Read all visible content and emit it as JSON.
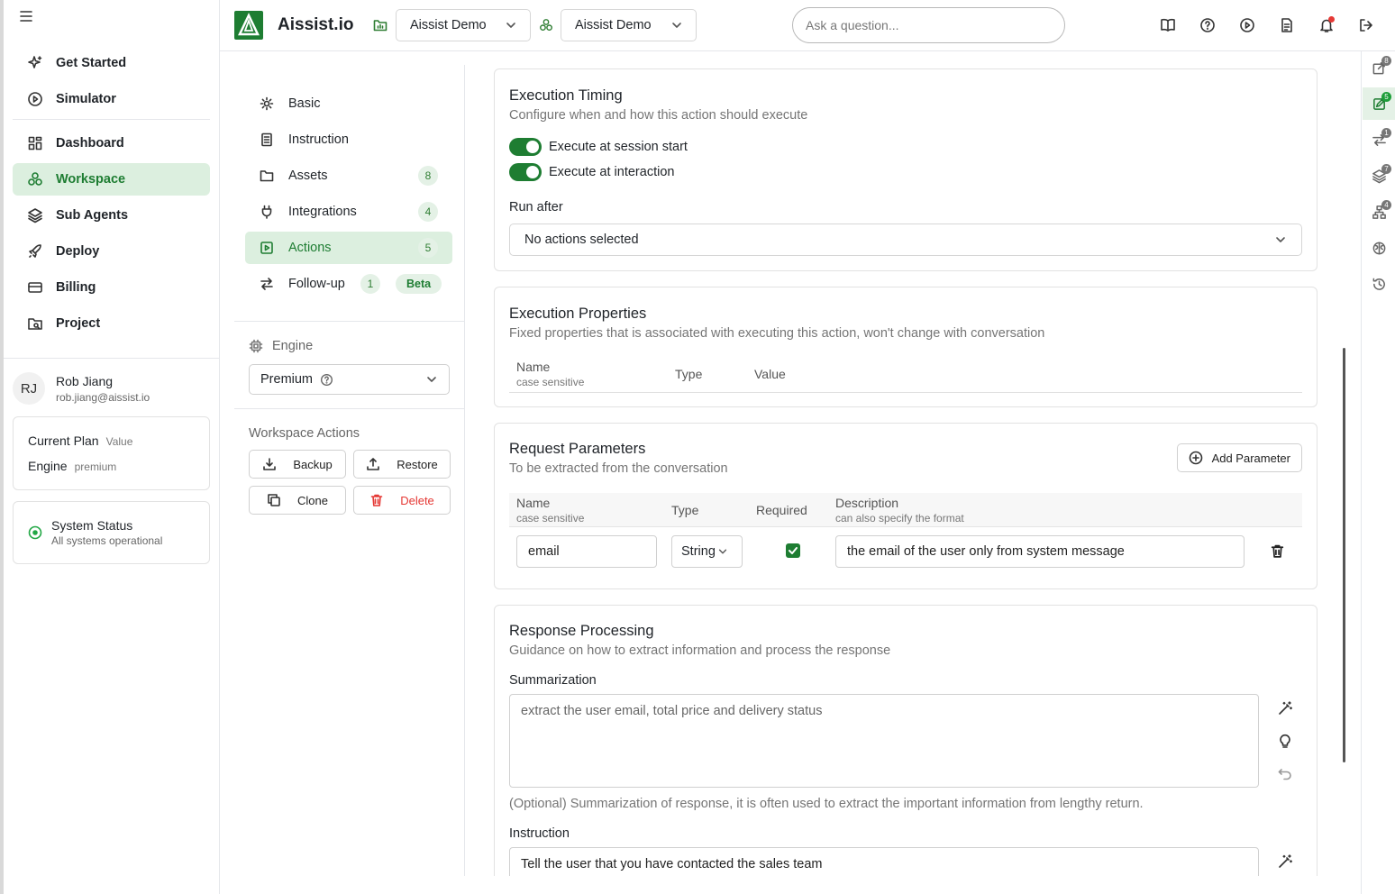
{
  "sidebar": {
    "nav": [
      {
        "label": "Get Started",
        "icon": "sparkles-icon",
        "active": false
      },
      {
        "label": "Simulator",
        "icon": "play-circle-icon",
        "active": false
      },
      {
        "label": "Dashboard",
        "icon": "dashboard-icon",
        "active": false
      },
      {
        "label": "Workspace",
        "icon": "workspace-icon",
        "active": true
      },
      {
        "label": "Sub Agents",
        "icon": "layers-icon",
        "active": false
      },
      {
        "label": "Deploy",
        "icon": "rocket-icon",
        "active": false
      },
      {
        "label": "Billing",
        "icon": "credit-card-icon",
        "active": false
      },
      {
        "label": "Project",
        "icon": "project-icon",
        "active": false
      }
    ],
    "user": {
      "initials": "RJ",
      "name": "Rob Jiang",
      "email": "rob.jiang@aissist.io"
    },
    "plan": {
      "plan_label": "Current Plan",
      "plan_value": "Value",
      "engine_label": "Engine",
      "engine_value": "premium"
    },
    "status": {
      "title": "System Status",
      "subtitle": "All systems operational"
    }
  },
  "topbar": {
    "brand": "Aissist.io",
    "project_select": "Aissist Demo",
    "workspace_select": "Aissist Demo",
    "ask_placeholder": "Ask a question...",
    "icons": [
      "book-icon",
      "help-icon",
      "play-icon",
      "document-icon",
      "bell-icon",
      "logout-icon"
    ],
    "has_notification": true
  },
  "subnav": {
    "items": [
      {
        "label": "Basic",
        "icon": "gear-icon",
        "count": null
      },
      {
        "label": "Instruction",
        "icon": "document-icon",
        "count": null
      },
      {
        "label": "Assets",
        "icon": "folder-icon",
        "count": "8"
      },
      {
        "label": "Integrations",
        "icon": "plug-icon",
        "count": "4"
      },
      {
        "label": "Actions",
        "icon": "action-icon",
        "count": "5",
        "active": true
      },
      {
        "label": "Follow-up",
        "icon": "arrows-icon",
        "count": "1",
        "badge": "Beta"
      }
    ],
    "engine_label": "Engine",
    "engine_value": "Premium",
    "actions_label": "Workspace Actions",
    "buttons": {
      "backup": "Backup",
      "restore": "Restore",
      "clone": "Clone",
      "delete": "Delete"
    }
  },
  "timing": {
    "title": "Execution Timing",
    "desc": "Configure when and how this action should execute",
    "toggle1": "Execute at session start",
    "toggle2": "Execute at interaction",
    "run_after_label": "Run after",
    "run_after_value": "No actions selected"
  },
  "exec_props": {
    "title": "Execution Properties",
    "desc": "Fixed properties that is associated with executing this action, won't change with conversation",
    "col_name": "Name",
    "col_name_sub": "case sensitive",
    "col_type": "Type",
    "col_value": "Value"
  },
  "request": {
    "title": "Request Parameters",
    "desc": "To be extracted from the conversation",
    "add_label": "Add Parameter",
    "col_name": "Name",
    "col_name_sub": "case sensitive",
    "col_type": "Type",
    "col_required": "Required",
    "col_desc": "Description",
    "col_desc_sub": "can also specify the format",
    "rows": [
      {
        "name": "email",
        "type": "String",
        "required": true,
        "description": "the email of the user only from system message"
      }
    ]
  },
  "response": {
    "title": "Response Processing",
    "desc": "Guidance on how to extract information and process the response",
    "summ_label": "Summarization",
    "summ_placeholder": "extract the user email, total price and delivery status",
    "summ_hint": "(Optional) Summarization of response, it is often used to extract the important information from lengthy return.",
    "instr_label": "Instruction",
    "instr_value": "Tell the user that you have contacted the sales team"
  },
  "rail": [
    {
      "icon": "share-icon",
      "badge": "8",
      "active": false
    },
    {
      "icon": "edit-doc-icon",
      "badge": "5",
      "active": true
    },
    {
      "icon": "transfer-icon",
      "badge": "1",
      "active": false
    },
    {
      "icon": "stack-icon",
      "badge": "7",
      "active": false
    },
    {
      "icon": "network-icon",
      "badge": "4",
      "active": false
    },
    {
      "icon": "brain-icon",
      "badge": null,
      "active": false
    },
    {
      "icon": "history-icon",
      "badge": null,
      "active": false
    }
  ],
  "colors": {
    "accent": "#1e7d32",
    "accent_light": "#dcefdf",
    "danger": "#e53935"
  }
}
